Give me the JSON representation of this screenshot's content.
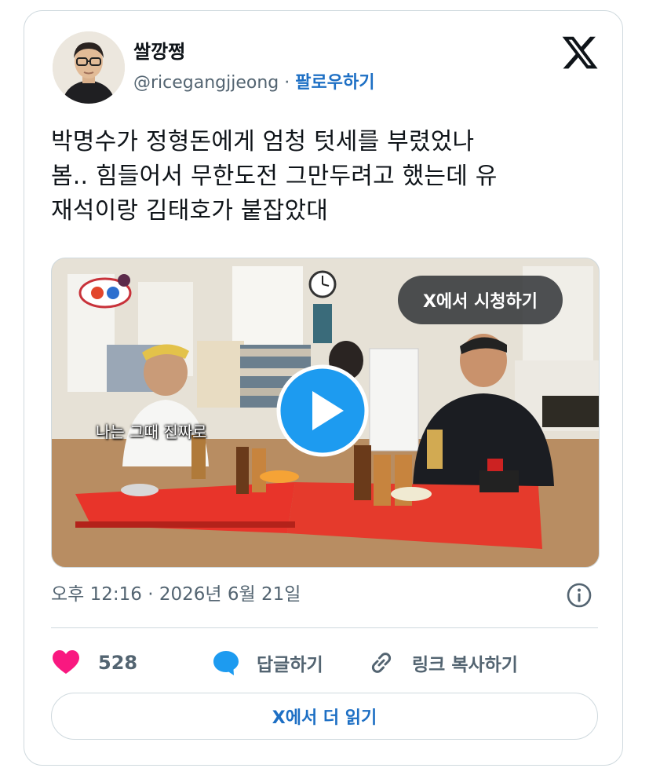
{
  "user": {
    "display_name": "쌀깡쩡",
    "handle": "@ricegangjjeong",
    "separator": "·",
    "follow_label": "팔로우하기"
  },
  "tweet": {
    "lines": [
      "박명수가 정형돈에게 엄청 텃세를 부렸었나",
      "봄.. 힘들어서 무한도전 그만두려고 했는데 유",
      "재석이랑 김태호가 붙잡았대"
    ]
  },
  "media": {
    "watch_label": "X에서 시청하기",
    "subtitle": "나는 그때 진짜로"
  },
  "meta": {
    "timestamp": "오후 12:16 · 2026년 6월 21일"
  },
  "actions": {
    "like_count": "528",
    "reply_label": "답글하기",
    "copy_link_label": "링크 복사하기"
  },
  "read_more_label": "X에서 더 읽기",
  "colors": {
    "accent": "#1d6fc4",
    "like": "#f91880",
    "reply": "#1d9bf0",
    "muted": "#536471"
  }
}
